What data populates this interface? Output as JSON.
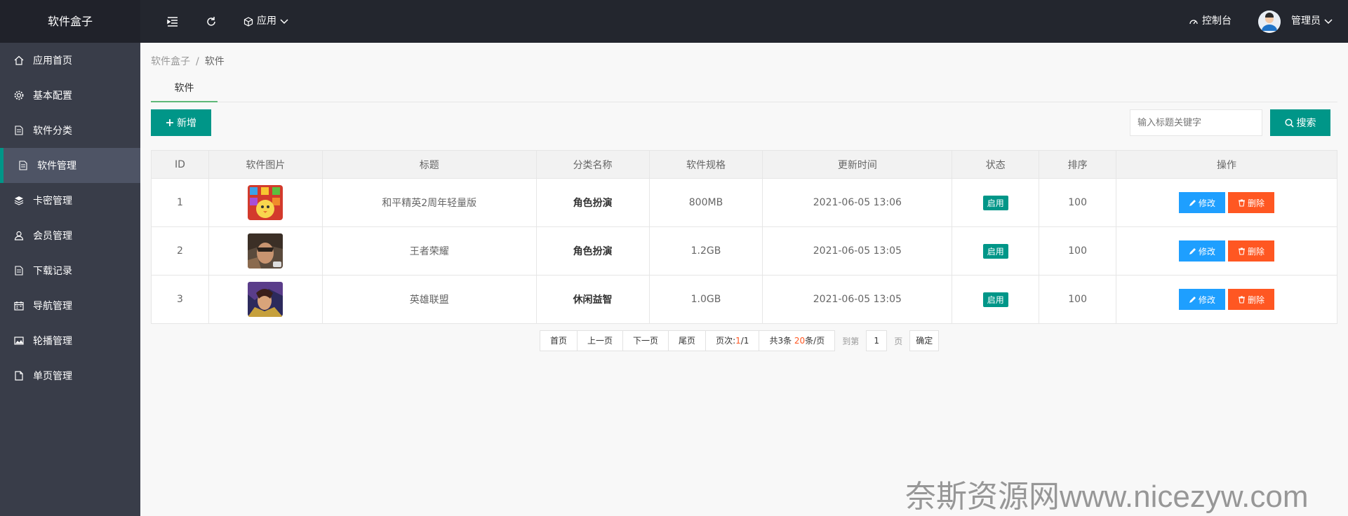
{
  "header": {
    "logo": "软件盒子",
    "app_menu": "应用",
    "console": "控制台",
    "user": "管理员"
  },
  "sidebar": {
    "items": [
      {
        "label": "应用首页",
        "icon": "home-icon"
      },
      {
        "label": "基本配置",
        "icon": "gear-icon"
      },
      {
        "label": "软件分类",
        "icon": "file-icon"
      },
      {
        "label": "软件管理",
        "icon": "file-icon",
        "active": true
      },
      {
        "label": "卡密管理",
        "icon": "layers-icon"
      },
      {
        "label": "会员管理",
        "icon": "user-icon"
      },
      {
        "label": "下载记录",
        "icon": "file-icon"
      },
      {
        "label": "导航管理",
        "icon": "calendar-icon"
      },
      {
        "label": "轮播管理",
        "icon": "image-icon"
      },
      {
        "label": "单页管理",
        "icon": "page-icon"
      }
    ]
  },
  "breadcrumb": {
    "root": "软件盒子",
    "sep": "/",
    "current": "软件"
  },
  "tabs": {
    "active": "软件"
  },
  "toolbar": {
    "add_label": "新增",
    "search_placeholder": "输入标题关键字",
    "search_label": "搜索"
  },
  "table": {
    "headers": [
      "ID",
      "软件图片",
      "标题",
      "分类名称",
      "软件规格",
      "更新时间",
      "状态",
      "排序",
      "操作"
    ],
    "rows": [
      {
        "id": "1",
        "title": "和平精英2周年轻量版",
        "category": "角色扮演",
        "size": "800MB",
        "updated": "2021-06-05 13:06",
        "status": "启用",
        "order": "100"
      },
      {
        "id": "2",
        "title": "王者荣耀",
        "category": "角色扮演",
        "size": "1.2GB",
        "updated": "2021-06-05 13:05",
        "status": "启用",
        "order": "100"
      },
      {
        "id": "3",
        "title": "英雄联盟",
        "category": "休闲益智",
        "size": "1.0GB",
        "updated": "2021-06-05 13:05",
        "status": "启用",
        "order": "100"
      }
    ],
    "edit_label": "修改",
    "delete_label": "删除"
  },
  "pagination": {
    "first": "首页",
    "prev": "上一页",
    "next": "下一页",
    "last": "尾页",
    "page_prefix": "页次:",
    "page_current": "1",
    "page_total": "/1",
    "total_prefix": "共3条 ",
    "per_page": "20",
    "per_page_suffix": "条/页",
    "goto_prefix": "到第",
    "goto_value": "1",
    "goto_suffix": "页",
    "confirm": "确定"
  },
  "watermark": "奈斯资源网www.nicezyw.com",
  "colors": {
    "primary": "#009688",
    "edit": "#1e9fff",
    "delete": "#ff5722",
    "header": "#23262e",
    "sidebar": "#393d49"
  }
}
